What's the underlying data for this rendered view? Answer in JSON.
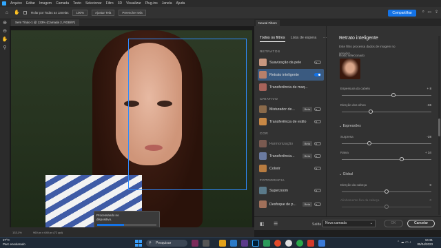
{
  "menu": [
    "Arquivo",
    "Editar",
    "Imagem",
    "Camada",
    "Texto",
    "Selecionar",
    "Filtro",
    "3D",
    "Visualizar",
    "Plug-ins",
    "Janela",
    "Ajuda"
  ],
  "options": {
    "scroll_all": "Rolar por Todas as Janelas",
    "zoom": "100%",
    "fit_screen": "Ajustar Tela",
    "fill_screen": "Preencher tela",
    "share": "Compartilhar"
  },
  "document": {
    "tab": "Sem Título-1 @ 133% (Camada 2, RGB/8*)",
    "zoom_status": "133,1%",
    "size_status": "960 px x 640 px (72 ppi)"
  },
  "processing": {
    "text_line1": "Processando no",
    "text_line2": "dispositivo.",
    "progress": 0.45
  },
  "neural": {
    "panel_title": "Neural Filters",
    "tabs": {
      "all": "Todos os filtros",
      "wait": "Lista de espera"
    },
    "categories": {
      "portraits": "RETRATOS",
      "creative": "CRIATIVO",
      "color": "COR",
      "photography": "FOTOGRAFIA"
    },
    "filters": {
      "skin": "Suavização da pele",
      "portrait": "Retrato inteligente",
      "makeup": "Transferência de maq...",
      "landscape": "Misturador de...",
      "style": "Transferência de estilo",
      "harmonize": "Harmonização",
      "transfer": "Transferência...",
      "colorize": "Colorir",
      "superzoom": "Superzoom",
      "blur": "Desfoque de p..."
    },
    "beta": "Beta",
    "settings": {
      "title": "Retrato inteligente",
      "desc1": "Este filtro processa dados de imagem no",
      "desc2": "servidor.",
      "selected_label": "Rosto selecionado",
      "hair": {
        "label": "Espessura do cabelo",
        "value": "+ 8",
        "fraction": 0.58
      },
      "eye": {
        "label": "Direção dos olhos",
        "value": "-36",
        "fraction": 0.32
      },
      "expressions": "Expressões",
      "surprise": {
        "label": "Surpresa",
        "value": "-38",
        "fraction": 0.31
      },
      "anger": {
        "label": "Raiva",
        "value": "+ 34",
        "fraction": 0.67
      },
      "global": "Global",
      "head": {
        "label": "Direção da cabeça",
        "value": "0",
        "fraction": 0.5
      },
      "align": {
        "label": "Alinhamento fixo da cabeça",
        "value": "0",
        "fraction": 0.5
      }
    },
    "output_label": "Saída",
    "output_value": "Nova camada",
    "ok": "OK",
    "cancel": "Cancelar"
  },
  "taskbar": {
    "temp": "27°C",
    "weather": "Parc ensolarado",
    "search": "Pesquisar",
    "time": "16:31",
    "date": "05/04/2023"
  }
}
